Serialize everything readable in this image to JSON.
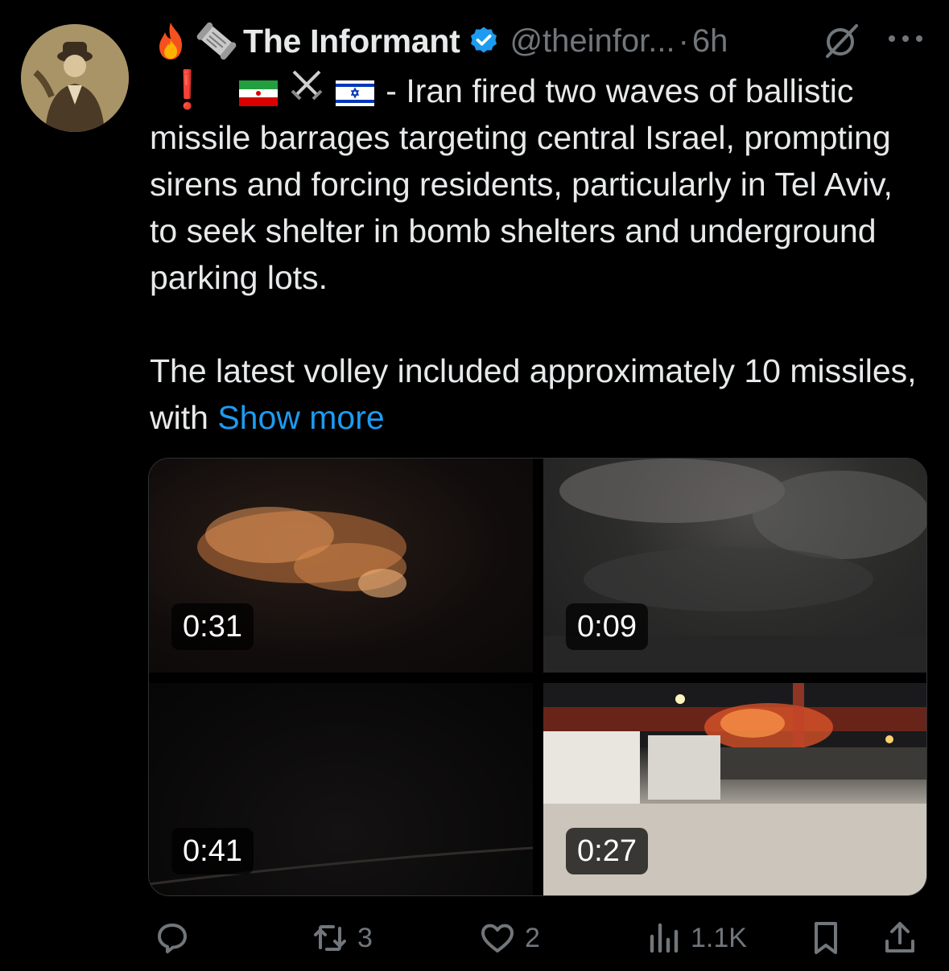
{
  "tweet": {
    "author": {
      "header_emojis": [
        "fire",
        "scroll"
      ],
      "display_name": "The Informant",
      "verified": true,
      "handle": "@theinfor...",
      "separator": "·",
      "time": "6h"
    },
    "text": {
      "line1_prefix_icons": [
        "exclamation",
        "iran-flag",
        "crossed-swords",
        "israel-flag"
      ],
      "exclamation": "❗",
      "para1": "- Iran fired two waves of ballistic missile barrages targeting central Israel, prompting sirens and forcing residents, particularly in Tel Aviv, to seek shelter in bomb shelters and underground parking lots.",
      "para2": "The latest volley included approximately 10 missiles, with",
      "show_more": "Show more"
    },
    "media": [
      {
        "duration": "0:31",
        "scene": "orange smoke cloud at night"
      },
      {
        "duration": "0:09",
        "scene": "grey smoke in night sky"
      },
      {
        "duration": "0:41",
        "scene": "dark night scene"
      },
      {
        "duration": "0:27",
        "scene": "fire behind white containers"
      }
    ],
    "actions": {
      "reply_count": "",
      "retweet_count": "3",
      "like_count": "2",
      "views_count": "1.1K"
    }
  },
  "colors": {
    "background": "#000000",
    "text": "#e7e9ea",
    "muted": "#71767b",
    "link": "#1d9bf0",
    "verified": "#1d9bf0"
  }
}
